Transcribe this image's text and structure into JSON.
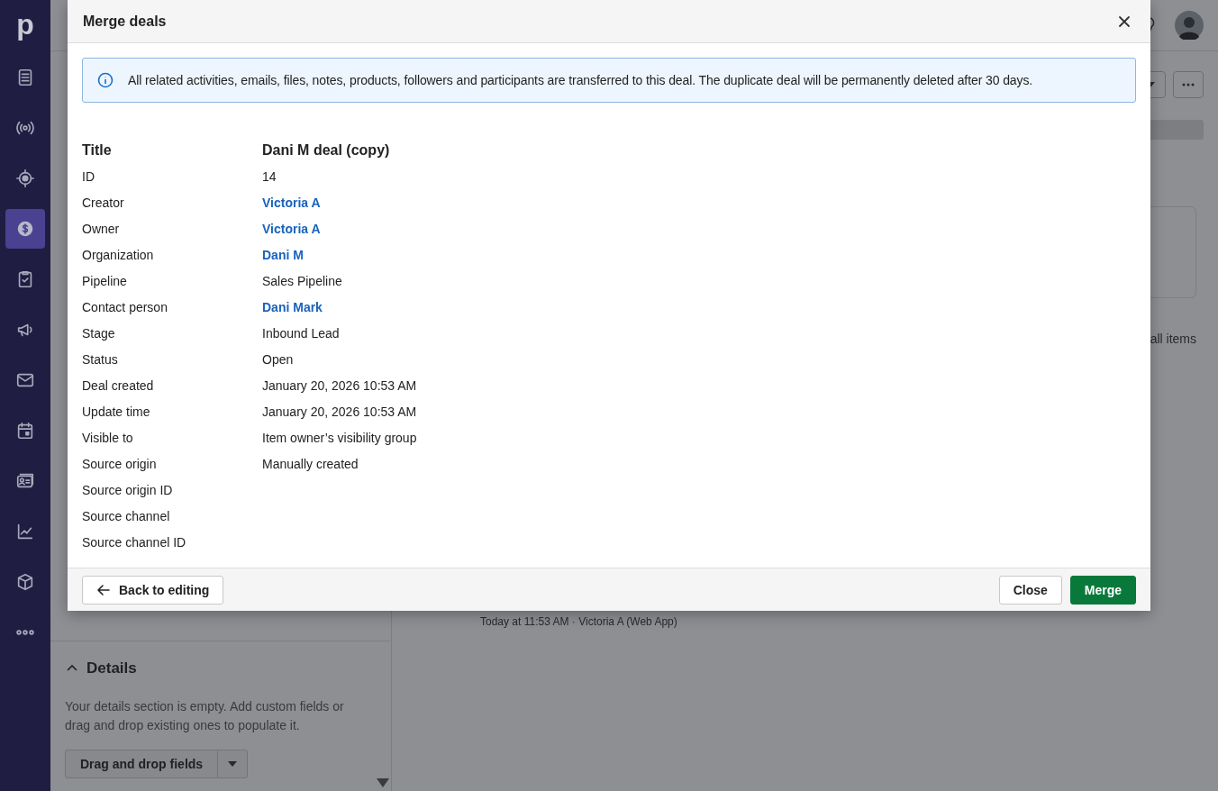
{
  "nav": {
    "logo": "p",
    "items": [
      {
        "selected": false
      },
      {
        "selected": false
      },
      {
        "selected": false
      },
      {
        "selected": true
      },
      {
        "selected": false
      },
      {
        "selected": false
      },
      {
        "selected": false
      },
      {
        "selected": false
      },
      {
        "selected": false
      },
      {
        "selected": false
      },
      {
        "selected": false
      },
      {
        "selected": false
      }
    ]
  },
  "background": {
    "list_link": "all items",
    "activity_meta": "Today at 11:53 AM · Victoria A (Web App)",
    "details": {
      "title": "Details",
      "expanded": true,
      "text": "Your details section is empty. Add custom fields or drag and drop existing ones to populate it.",
      "button": "Drag and drop fields"
    }
  },
  "modal": {
    "title": "Merge deals",
    "notice": "All related activities, emails, files, notes, products, followers and participants are transferred to this deal. The duplicate deal will be permanently deleted after 30 days.",
    "fields": [
      {
        "label": "Title",
        "value": "Dani M deal (copy)",
        "kind": "heading"
      },
      {
        "label": "ID",
        "value": "14",
        "kind": "text"
      },
      {
        "label": "Creator",
        "value": "Victoria A",
        "kind": "link"
      },
      {
        "label": "Owner",
        "value": "Victoria A",
        "kind": "link"
      },
      {
        "label": "Organization",
        "value": "Dani M",
        "kind": "link"
      },
      {
        "label": "Pipeline",
        "value": "Sales Pipeline",
        "kind": "text"
      },
      {
        "label": "Contact person",
        "value": "Dani Mark",
        "kind": "link"
      },
      {
        "label": "Stage",
        "value": "Inbound Lead",
        "kind": "text"
      },
      {
        "label": "Status",
        "value": "Open",
        "kind": "text"
      },
      {
        "label": "Deal created",
        "value": "January 20, 2026 10:53 AM",
        "kind": "text"
      },
      {
        "label": "Update time",
        "value": "January 20, 2026 10:53 AM",
        "kind": "text"
      },
      {
        "label": "Visible to",
        "value": "Item owner’s visibility group",
        "kind": "text"
      },
      {
        "label": "Source origin",
        "value": "Manually created",
        "kind": "text"
      },
      {
        "label": "Source origin ID",
        "kind": "text"
      },
      {
        "label": "Source channel",
        "kind": "text"
      },
      {
        "label": "Source channel ID",
        "kind": "text"
      }
    ],
    "buttons": {
      "back": "Back to editing",
      "close": "Close",
      "merge": "Merge"
    }
  }
}
